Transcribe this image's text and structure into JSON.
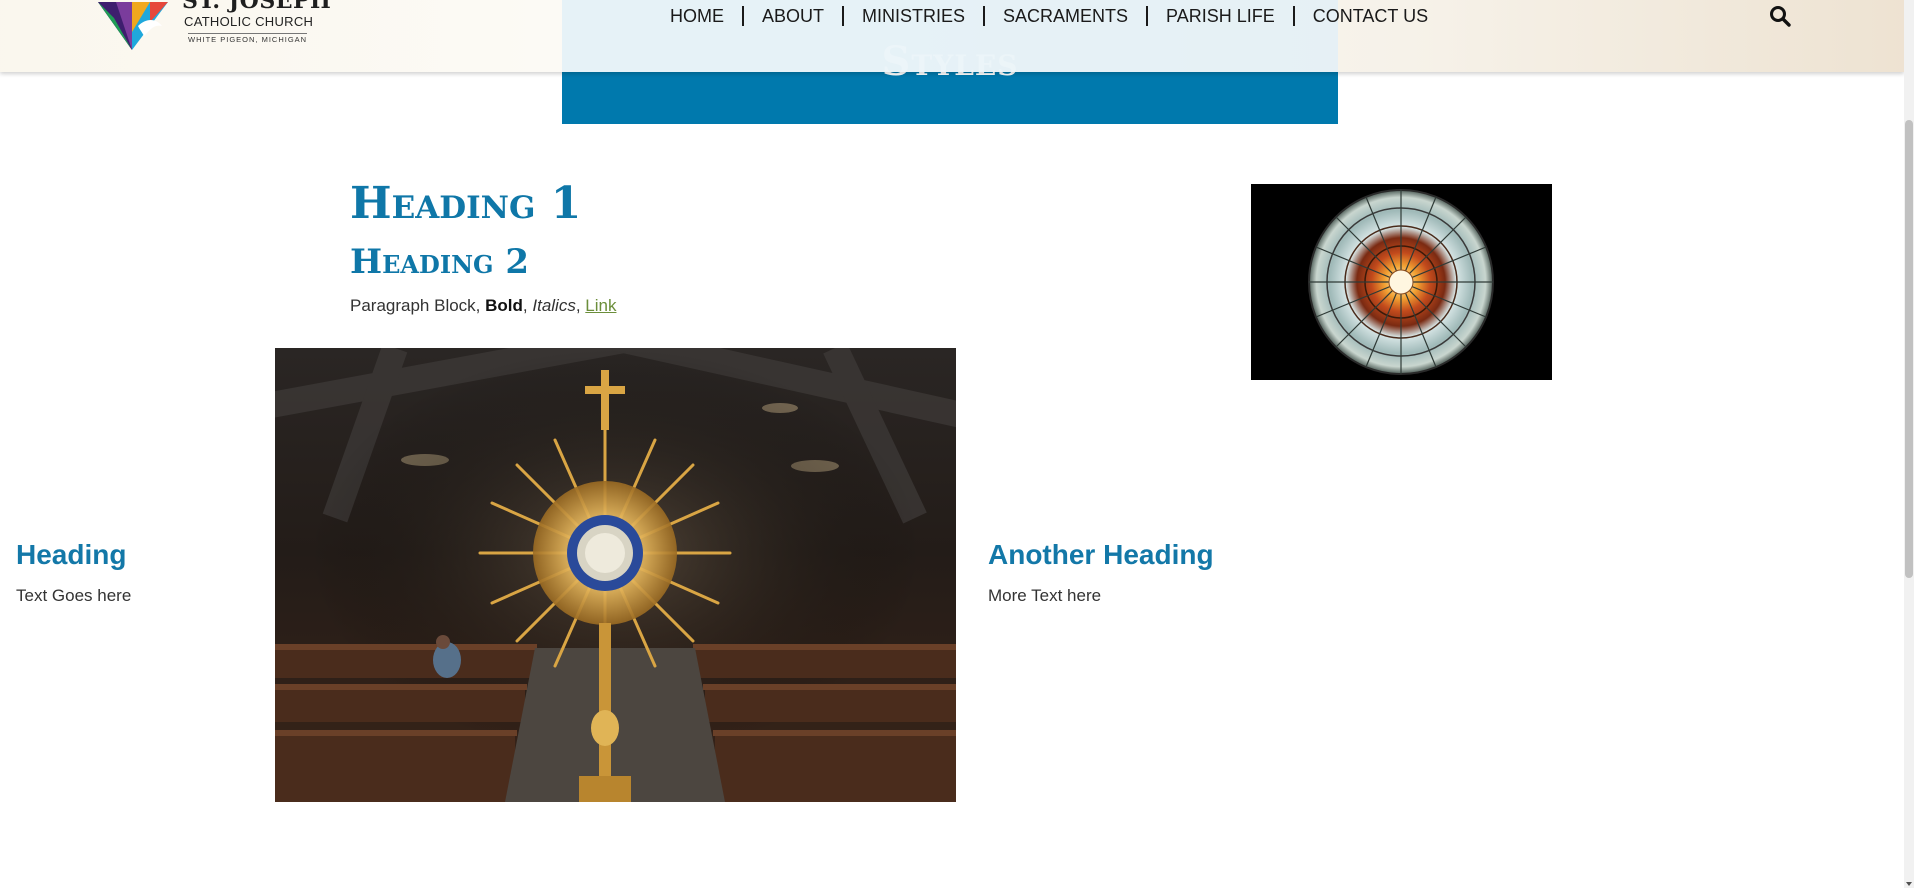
{
  "header": {
    "logo": {
      "line1": "ST. JOSEPH",
      "line2": "CATHOLIC CHURCH",
      "line3": "WHITE PIGEON, MICHIGAN"
    },
    "nav": [
      {
        "label": "HOME"
      },
      {
        "label": "ABOUT"
      },
      {
        "label": "MINISTRIES"
      },
      {
        "label": "SACRAMENTS"
      },
      {
        "label": "PARISH LIFE"
      },
      {
        "label": "CONTACT US"
      }
    ],
    "search_icon": "search-icon"
  },
  "banner": {
    "title": "Styles",
    "color": "#0079ad"
  },
  "content": {
    "heading1": "Heading 1",
    "heading2": "Heading 2",
    "paragraph": {
      "plain": "Paragraph Block, ",
      "bold": "Bold",
      "sep1": ", ",
      "italic": "Italics",
      "sep2": ", ",
      "link": "Link"
    },
    "left_column": {
      "heading": "Heading",
      "text": "Text Goes here"
    },
    "right_column": {
      "heading": "Another Heading",
      "text": "More Text here"
    }
  },
  "colors": {
    "accent": "#0f77a8",
    "link": "#6b8e3a",
    "text": "#333333"
  }
}
